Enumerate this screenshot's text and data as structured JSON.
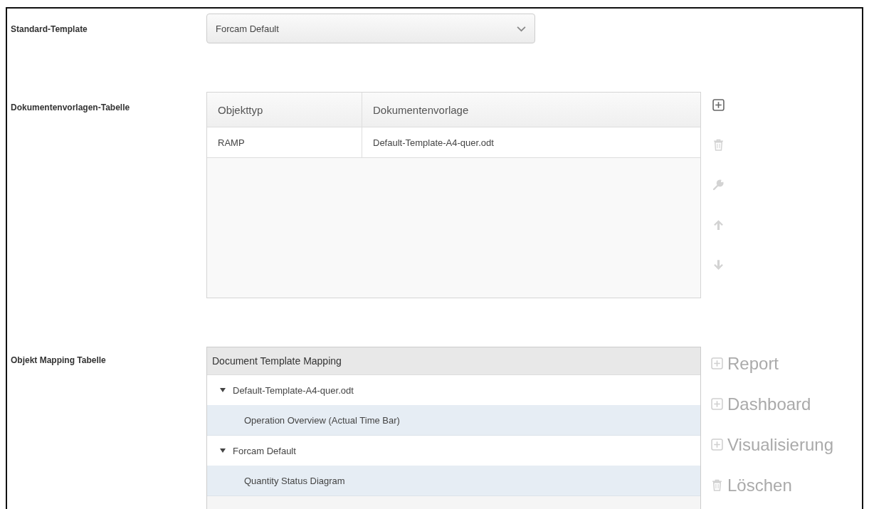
{
  "standard_template": {
    "label": "Standard-Template",
    "select": {
      "value": "Forcam Default"
    }
  },
  "document_table": {
    "label": "Dokumentenvorlagen-Tabelle",
    "columns": [
      "Objekttyp",
      "Dokumentenvorlage"
    ],
    "rows": [
      [
        "RAMP",
        "Default-Template-A4-quer.odt"
      ]
    ],
    "tools": [
      {
        "kind": "add",
        "disabled": false
      },
      {
        "kind": "delete",
        "disabled": true
      },
      {
        "kind": "edit",
        "disabled": true
      },
      {
        "kind": "up",
        "disabled": true
      },
      {
        "kind": "down",
        "disabled": true
      }
    ]
  },
  "mapping_table": {
    "label": "Objekt Mapping Tabelle",
    "heading": "Document Template Mapping",
    "tree": [
      {
        "label": "Default-Template-A4-quer.odt",
        "expanded": true,
        "children": [
          {
            "label": "Operation Overview (Actual Time Bar)"
          }
        ]
      },
      {
        "label": "Forcam Default",
        "expanded": true,
        "children": [
          {
            "label": "Quantity Status Diagram"
          }
        ]
      }
    ],
    "actions": [
      {
        "kind": "add",
        "label": "Report",
        "disabled": true
      },
      {
        "kind": "add",
        "label": "Dashboard",
        "disabled": true
      },
      {
        "kind": "add",
        "label": "Visualisierung",
        "disabled": true
      },
      {
        "kind": "delete",
        "label": "Löschen",
        "disabled": true
      }
    ]
  }
}
